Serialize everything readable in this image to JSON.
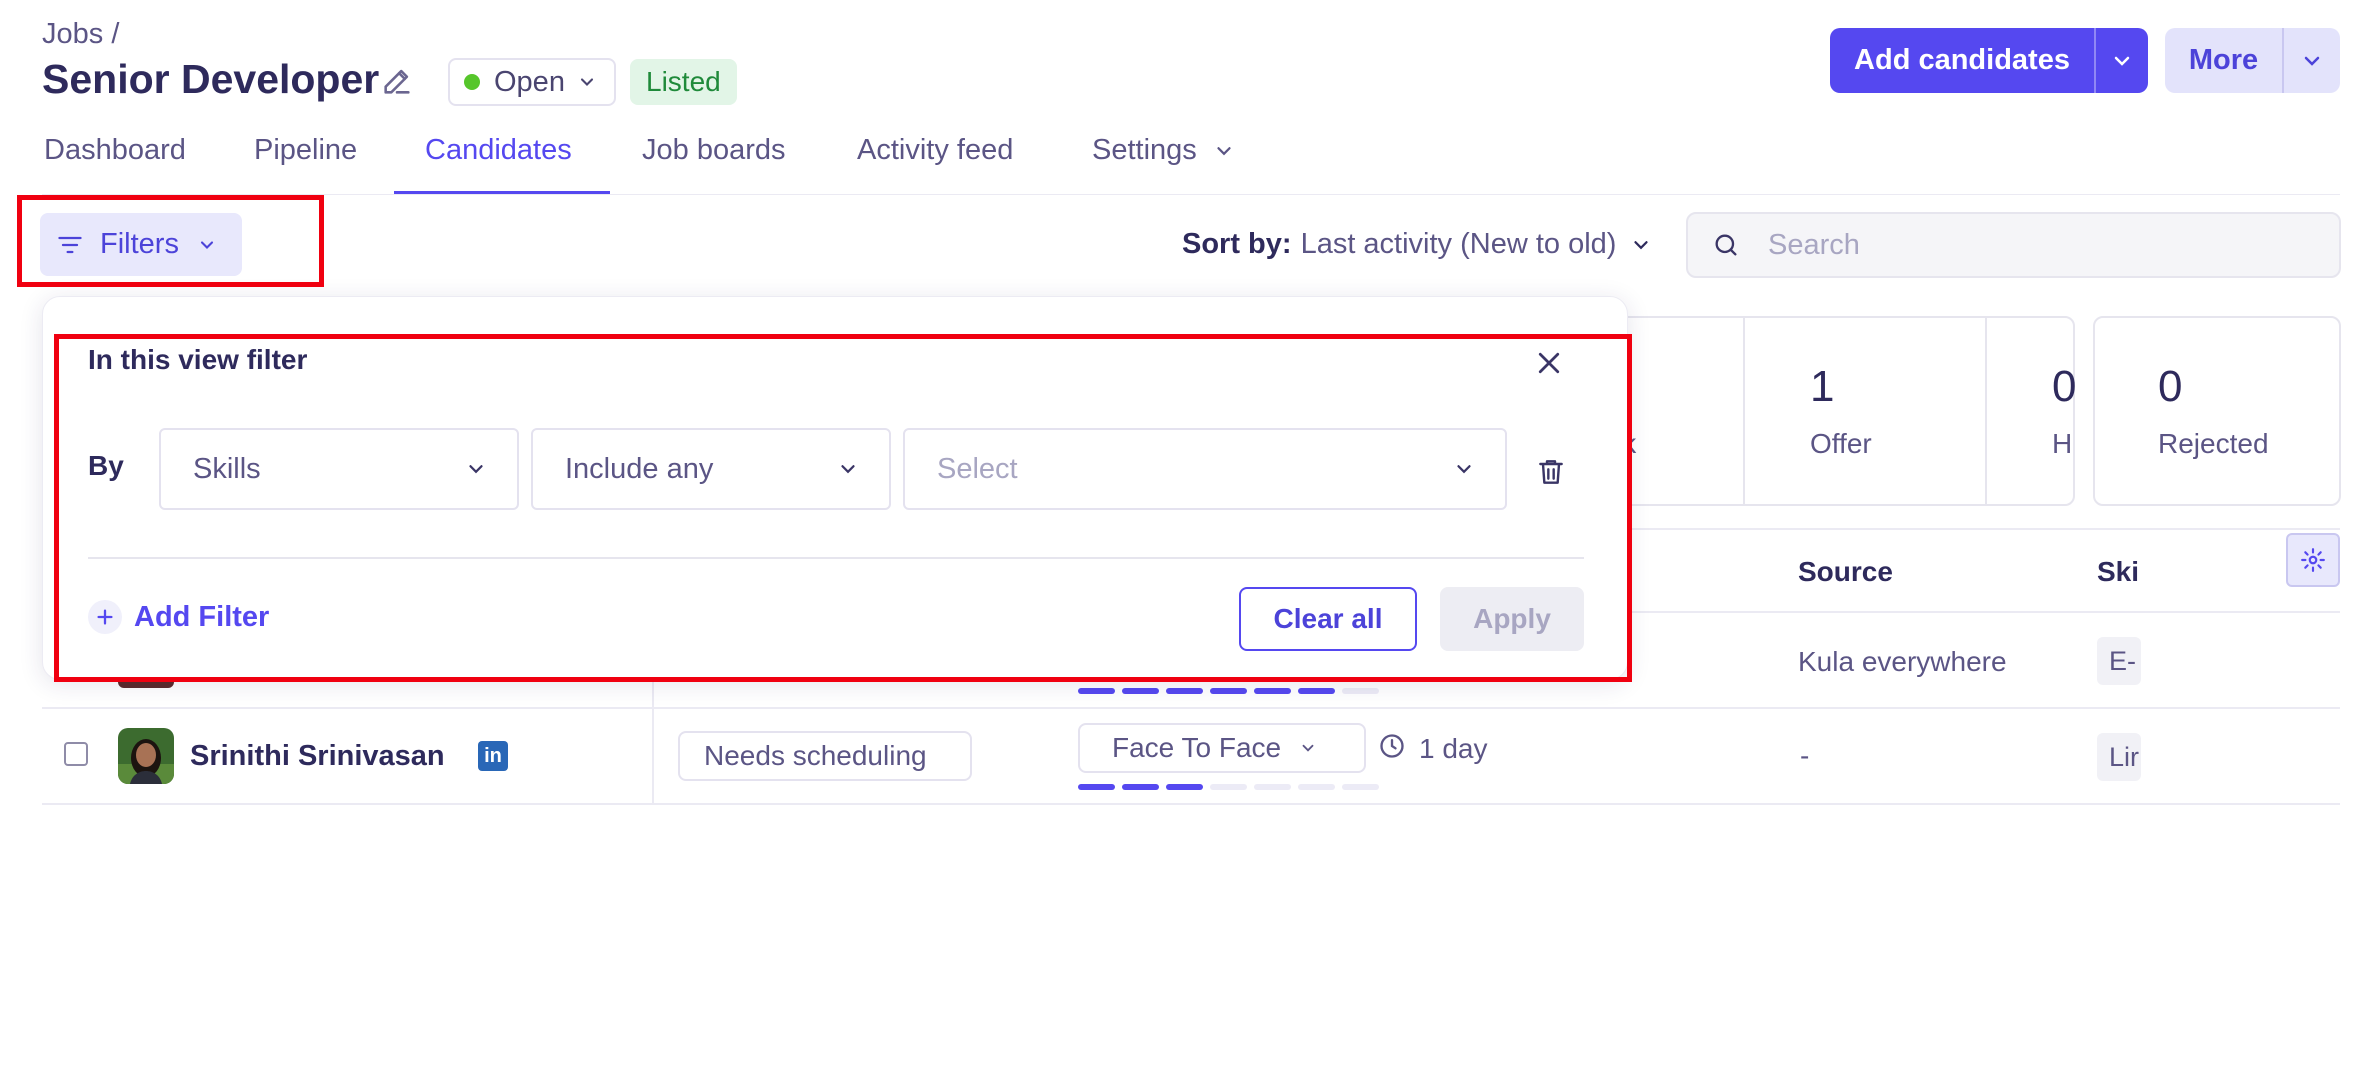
{
  "header": {
    "breadcrumb": "Jobs /",
    "title": "Senior Developer",
    "status": "Open",
    "listed_badge": "Listed",
    "add_candidates_label": "Add candidates",
    "more_label": "More"
  },
  "tabs": [
    {
      "label": "Dashboard"
    },
    {
      "label": "Pipeline"
    },
    {
      "label": "Candidates",
      "active": true
    },
    {
      "label": "Job boards"
    },
    {
      "label": "Activity feed"
    },
    {
      "label": "Settings"
    }
  ],
  "toolbar": {
    "filters_label": "Filters",
    "sort_label": "Sort by:",
    "sort_value": "Last activity (New to old)",
    "search_placeholder": "Search"
  },
  "stages": [
    {
      "count": "",
      "label": "ik"
    },
    {
      "count": "1",
      "label": "Offer"
    },
    {
      "count": "0",
      "label": "H"
    },
    {
      "count": "0",
      "label": "Rejected"
    }
  ],
  "table": {
    "headers": {
      "source": "Source",
      "skills": "Ski"
    },
    "rows": [
      {
        "source": "Kula everywhere",
        "skill": "E-",
        "progress": 6
      },
      {
        "name": "Srinithi Srinivasan",
        "linkedin": "in",
        "status": "Needs scheduling",
        "stage": "Face To Face",
        "time": "1 day",
        "source": "-",
        "skill": "Lir",
        "progress": 3
      }
    ]
  },
  "filter_popover": {
    "title": "In this view filter",
    "by_label": "By",
    "field": "Skills",
    "operator": "Include any",
    "value_placeholder": "Select",
    "add_filter_label": "Add Filter",
    "clear_all_label": "Clear all",
    "apply_label": "Apply"
  },
  "colors": {
    "accent": "#5548f0",
    "highlight": "#f00010",
    "status_open": "#56c62b",
    "listed_bg": "#e2f5e7",
    "listed_text": "#1f8a3a"
  }
}
